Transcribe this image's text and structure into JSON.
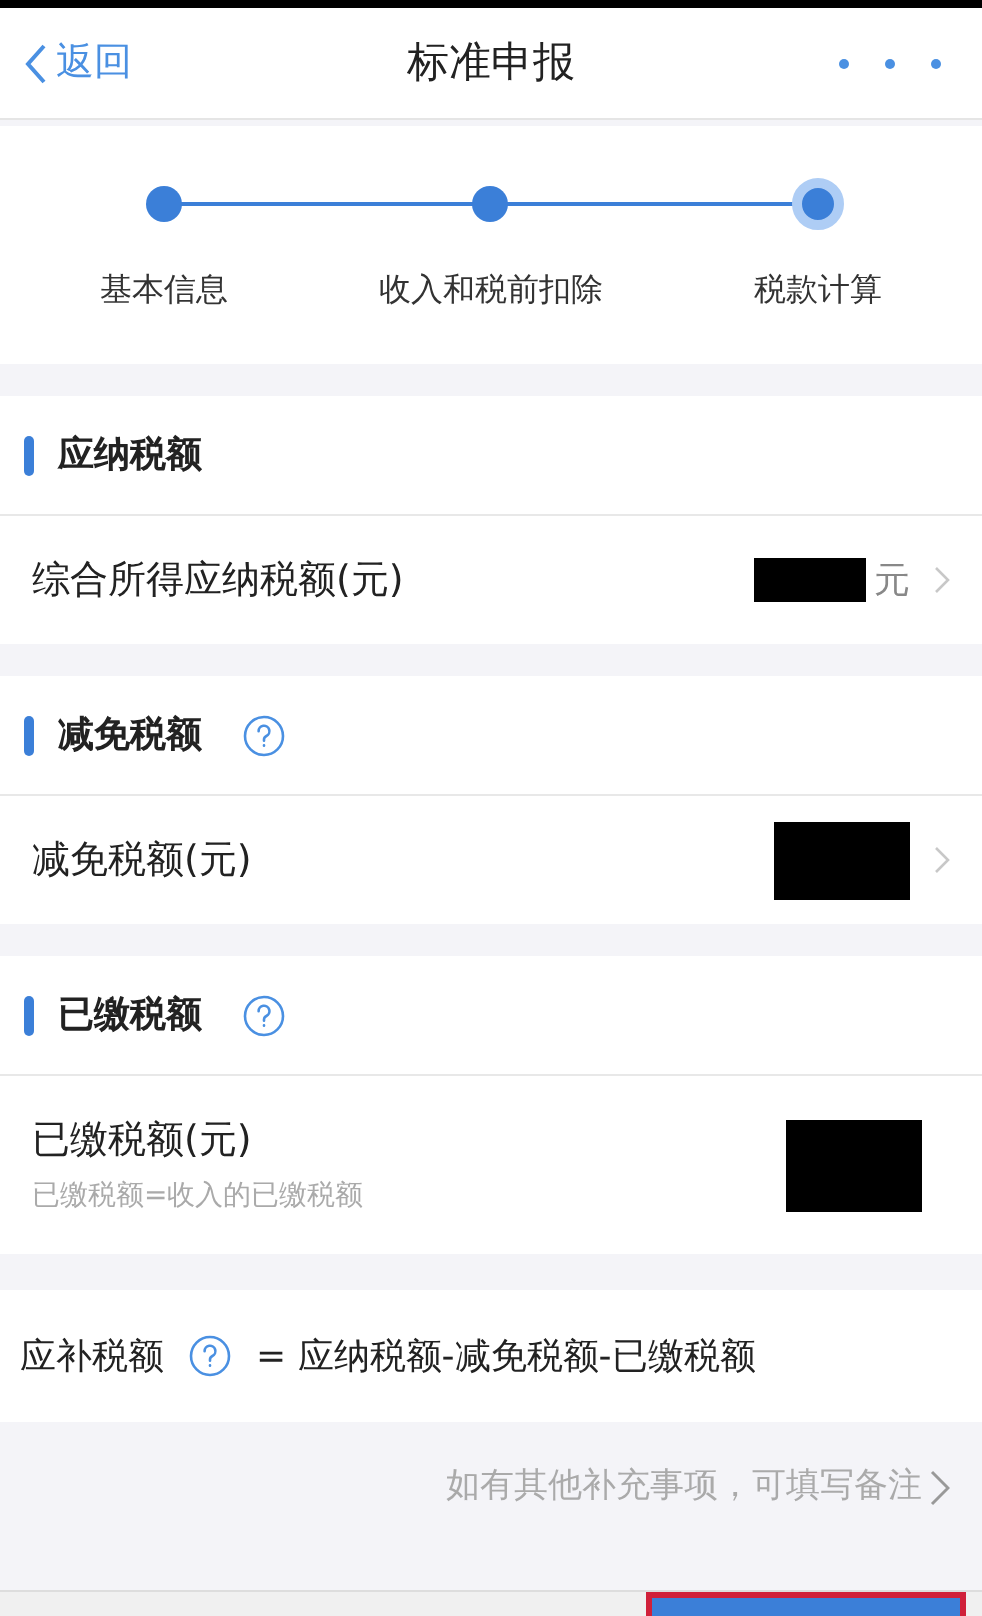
{
  "header": {
    "back": "返回",
    "title": "标准申报"
  },
  "steps": [
    {
      "label": "基本信息",
      "selected": false
    },
    {
      "label": "收入和税前扣除",
      "selected": false
    },
    {
      "label": "税款计算",
      "selected": true
    }
  ],
  "sections": [
    {
      "title": "应纳税额",
      "help": false,
      "rows": [
        {
          "label": "综合所得应纳税额(元)",
          "unit": "元",
          "chevron": true
        }
      ]
    },
    {
      "title": "减免税额",
      "help": true,
      "rows": [
        {
          "label": "减免税额(元)",
          "chevron": true
        }
      ]
    },
    {
      "title": "已缴税额",
      "help": true,
      "rows": [
        {
          "label": "已缴税额(元)",
          "note": "已缴税额=收入的已缴税额",
          "chevron": false
        }
      ]
    }
  ],
  "formula": {
    "label": "应补税额",
    "text": "= 应纳税额-减免税额-已缴税额"
  },
  "remark_link": "如有其他补充事项，可填写备注"
}
